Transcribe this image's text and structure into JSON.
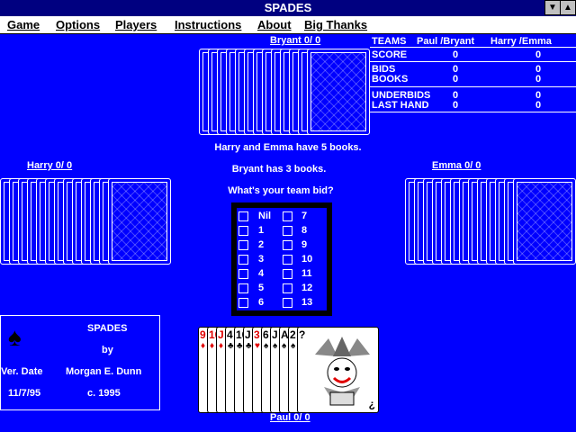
{
  "window": {
    "title": "SPADES"
  },
  "menu": [
    "Game",
    "Options",
    "Players",
    "Instructions",
    "About",
    "Big Thanks"
  ],
  "players": {
    "north": "Bryant  0/ 0",
    "west": "Harry  0/ 0",
    "east": "Emma  0/ 0",
    "south": "Paul  0/ 0"
  },
  "scoreboard": {
    "teams_label": "TEAMS",
    "team1": "Paul /Bryant",
    "team2": "Harry /Emma",
    "rows": [
      {
        "label": "SCORE",
        "t1": "0",
        "t2": "0"
      },
      {
        "label": "BIDS",
        "t1": "0",
        "t2": "0"
      },
      {
        "label": "BOOKS",
        "t1": "0",
        "t2": "0"
      },
      {
        "label": "UNDERBIDS",
        "t1": "0",
        "t2": "0"
      },
      {
        "label": "LAST HAND",
        "t1": "0",
        "t2": "0"
      }
    ]
  },
  "messages": {
    "line1": "Harry  and Emma  have  5 books.",
    "line2": "Bryant  has  3 books.",
    "line3": "What's your team bid?"
  },
  "bids": {
    "left": [
      "Nil",
      "1",
      "2",
      "3",
      "4",
      "5",
      "6"
    ],
    "right": [
      "7",
      "8",
      "9",
      "10",
      "11",
      "12",
      "13"
    ]
  },
  "info": {
    "name": "SPADES",
    "by": "by",
    "ver_label": "Ver. Date",
    "author": "Morgan E. Dunn",
    "date": "11/7/95",
    "copyright": "c. 1995"
  },
  "hand": [
    {
      "rank": "9",
      "suit": "♦",
      "color": "red"
    },
    {
      "rank": "10",
      "suit": "♦",
      "color": "red"
    },
    {
      "rank": "J",
      "suit": "♦",
      "color": "red"
    },
    {
      "rank": "4",
      "suit": "♣",
      "color": "black"
    },
    {
      "rank": "10",
      "suit": "♣",
      "color": "black"
    },
    {
      "rank": "J",
      "suit": "♣",
      "color": "black"
    },
    {
      "rank": "3",
      "suit": "♥",
      "color": "red"
    },
    {
      "rank": "6",
      "suit": "♠",
      "color": "black"
    },
    {
      "rank": "J",
      "suit": "♠",
      "color": "black"
    },
    {
      "rank": "A",
      "suit": "♠",
      "color": "black"
    },
    {
      "rank": "2",
      "suit": "♠",
      "color": "black"
    },
    {
      "rank": "?",
      "suit": "",
      "color": "black"
    }
  ],
  "joker_corner": "¿"
}
